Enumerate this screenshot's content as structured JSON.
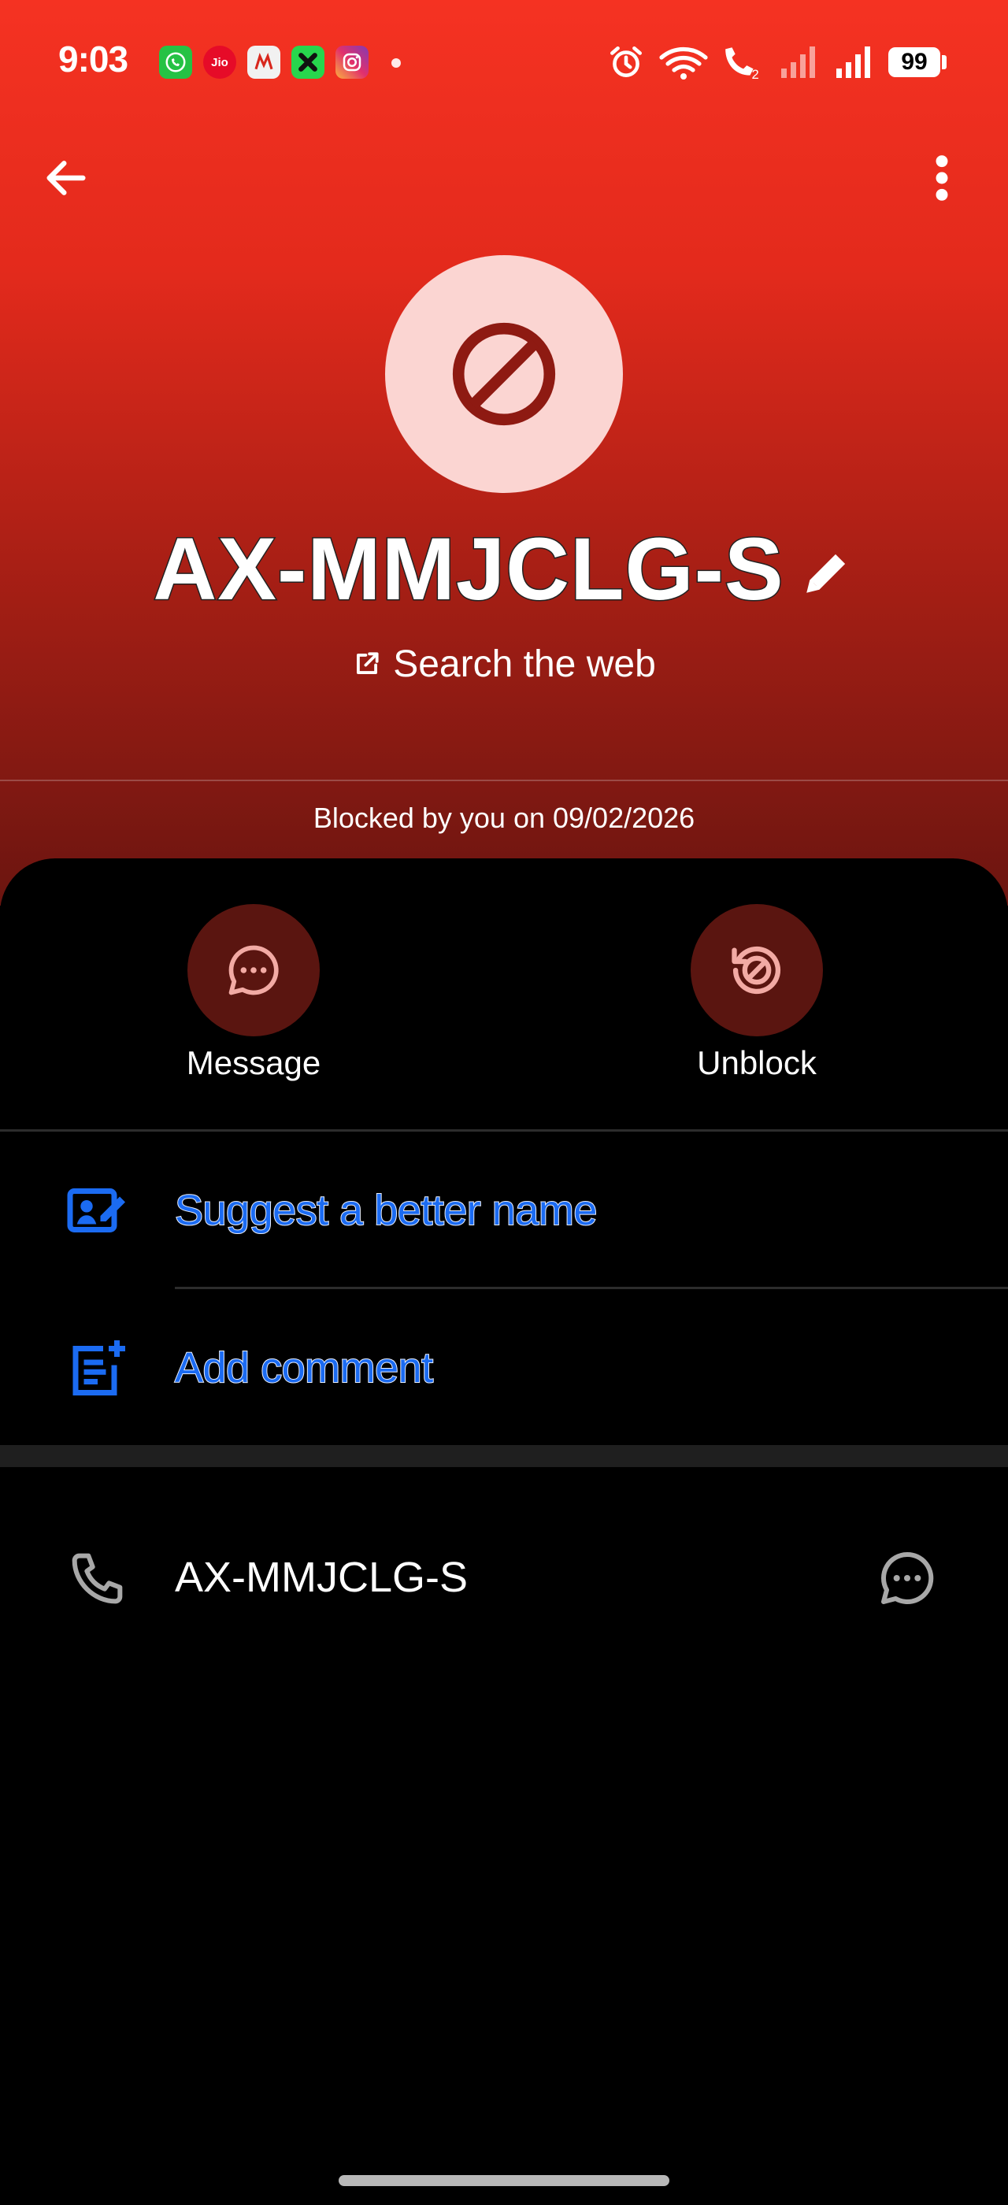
{
  "status_bar": {
    "time": "9:03",
    "apps": [
      "whatsapp-icon",
      "jio-icon",
      "my-jio-icon",
      "xbox-icon",
      "instagram-icon"
    ],
    "jio_label": "Jio",
    "battery_level": "99"
  },
  "contact": {
    "name": "AX-MMJCLG-S",
    "search_web_label": "Search the web",
    "blocked_note": "Blocked by you on 09/02/2026"
  },
  "actions": {
    "message_label": "Message",
    "unblock_label": "Unblock"
  },
  "options": {
    "suggest_name_label": "Suggest a better name",
    "add_comment_label": "Add comment"
  },
  "numbers": [
    {
      "value": "AX-MMJCLG-S"
    }
  ],
  "colors": {
    "header_top": "#f53222",
    "header_bottom": "#6b1510",
    "avatar_bg": "#fbd5d2",
    "action_circle": "#5a1510",
    "link_blue": "#1b6bf2"
  }
}
